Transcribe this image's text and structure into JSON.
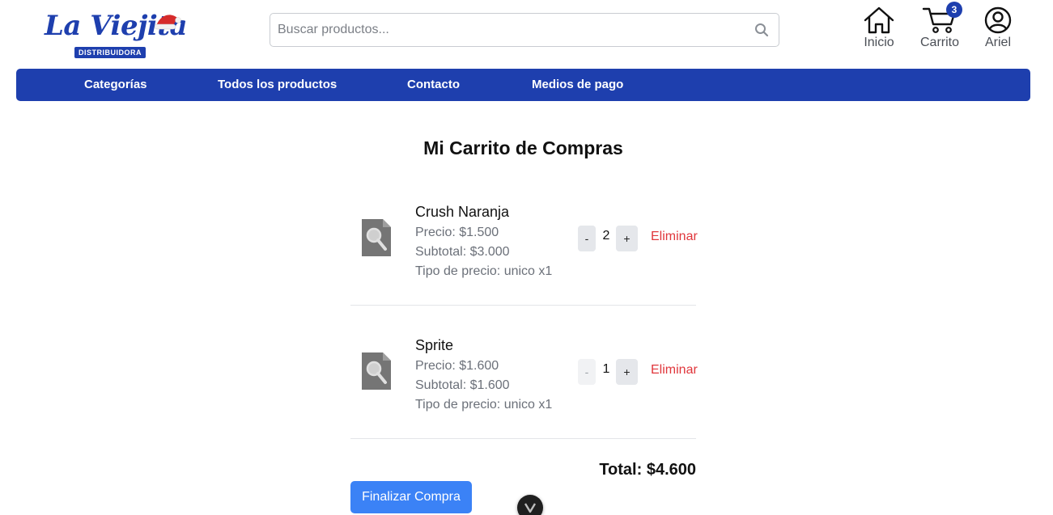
{
  "brand": {
    "name": "La Viejita",
    "tagline": "DISTRIBUIDORA",
    "color": "#1e3fae"
  },
  "search": {
    "placeholder": "Buscar productos...",
    "value": "",
    "icon": "search-icon"
  },
  "header_nav": {
    "home": {
      "label": "Inicio",
      "icon": "home-icon"
    },
    "cart": {
      "label": "Carrito",
      "icon": "cart-icon",
      "badge": "3"
    },
    "user": {
      "label": "Ariel",
      "icon": "user-icon"
    }
  },
  "menu": {
    "items": [
      {
        "label": "Categorías"
      },
      {
        "label": "Todos los productos"
      },
      {
        "label": "Contacto"
      },
      {
        "label": "Medios de pago"
      }
    ]
  },
  "cart": {
    "title": "Mi Carrito de Compras",
    "items": [
      {
        "name": "Crush Naranja",
        "price": "Precio: $1.500",
        "subtotal": "Subtotal: $3.000",
        "price_type": "Tipo de precio: unico x1",
        "quantity": "2",
        "decrement": "-",
        "increment": "+",
        "remove": "Eliminar"
      },
      {
        "name": "Sprite",
        "price": "Precio: $1.600",
        "subtotal": "Subtotal: $1.600",
        "price_type": "Tipo de precio: unico x1",
        "quantity": "1",
        "decrement": "-",
        "increment": "+",
        "remove": "Eliminar"
      }
    ],
    "total": "Total: $4.600",
    "checkout_label": "Finalizar Compra"
  },
  "colors": {
    "primary": "#1e3fae",
    "button": "#3b82f6",
    "danger": "#e0363b"
  }
}
